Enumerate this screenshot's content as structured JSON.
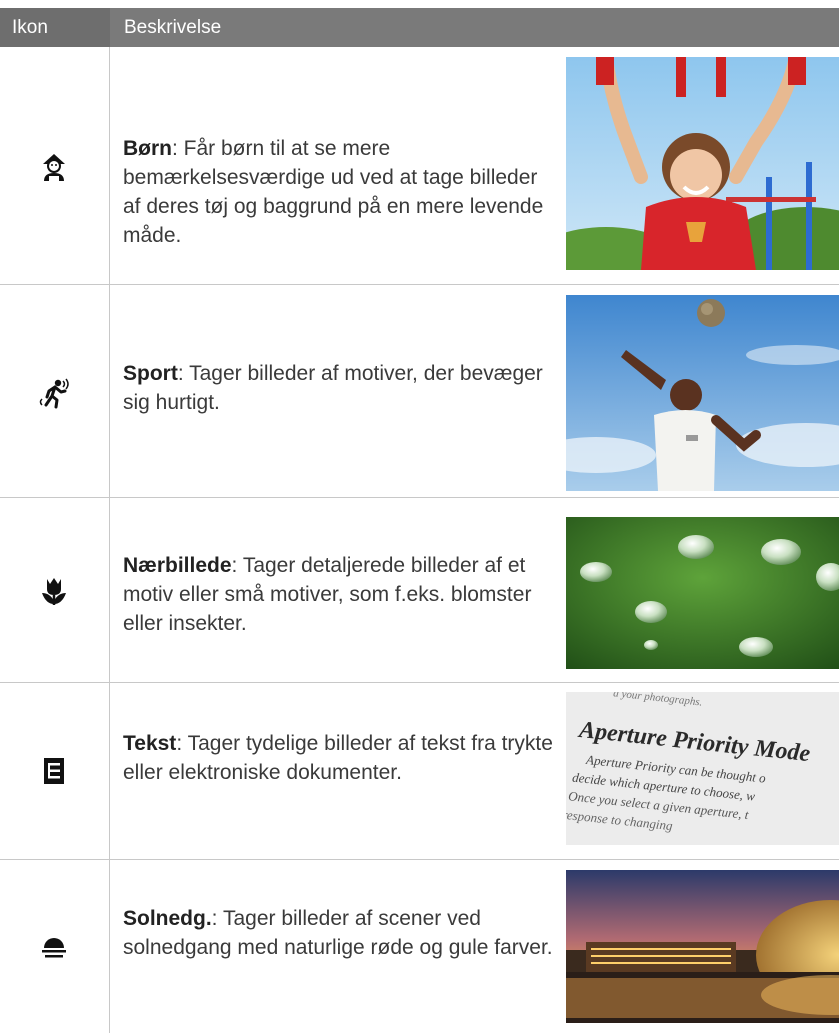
{
  "table": {
    "header_icon": "Ikon",
    "header_description": "Beskrivelse"
  },
  "rows": [
    {
      "icon": "child-icon",
      "title": "Børn",
      "text": ": Får børn til at se mere bemærkelsesværdige ud ved at tage billeder af deres tøj og baggrund på en mere levende måde.",
      "photo": "child-on-playground-photo"
    },
    {
      "icon": "sport-runner-icon",
      "title": "Sport",
      "text": ": Tager billeder af motiver, der bevæger sig hurtigt.",
      "photo": "basketball-player-photo"
    },
    {
      "icon": "macro-flower-icon",
      "title": "Nærbillede",
      "text": ": Tager detaljerede billeder af et motiv eller små motiver, som f.eks. blomster eller insekter.",
      "photo": "water-drops-on-leaf-photo"
    },
    {
      "icon": "text-document-icon",
      "title": "Tekst",
      "text": ": Tager tydelige billeder af tekst fra trykte eller elektroniske dokumenter.",
      "photo": "printed-book-page-photo"
    },
    {
      "icon": "sunset-icon",
      "title": "Solnedg.",
      "text": ": Tager billeder af scener ved solnedgang med naturlige røde og gule farver.",
      "photo": "sunset-building-photo"
    }
  ],
  "photo_text": {
    "line0": "a your photographs.",
    "heading": "Aperture Priority Mode",
    "line1": "Aperture Priority can be thought o",
    "line2": "decide which aperture to choose, w",
    "line3": "Once you select a given aperture, t",
    "line4": "response to changing"
  }
}
